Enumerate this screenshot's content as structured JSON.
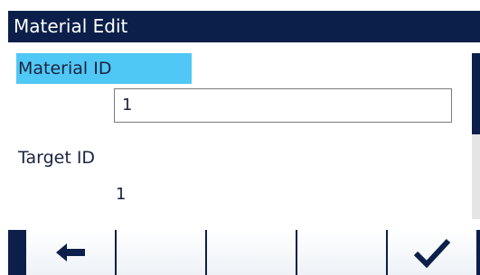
{
  "window": {
    "title": "Material Edit"
  },
  "fields": [
    {
      "label": "Material ID",
      "value": "1"
    },
    {
      "label": "Target ID",
      "value": "1"
    }
  ],
  "softkeys": [
    {
      "icon": "arrow-left-icon"
    },
    {
      "icon": ""
    },
    {
      "icon": ""
    },
    {
      "icon": ""
    },
    {
      "icon": "checkmark-icon"
    }
  ],
  "colors": {
    "title_bar": "#0b1f4a",
    "selection": "#50c8f5",
    "softkey_bar": "#0b1f4a"
  }
}
